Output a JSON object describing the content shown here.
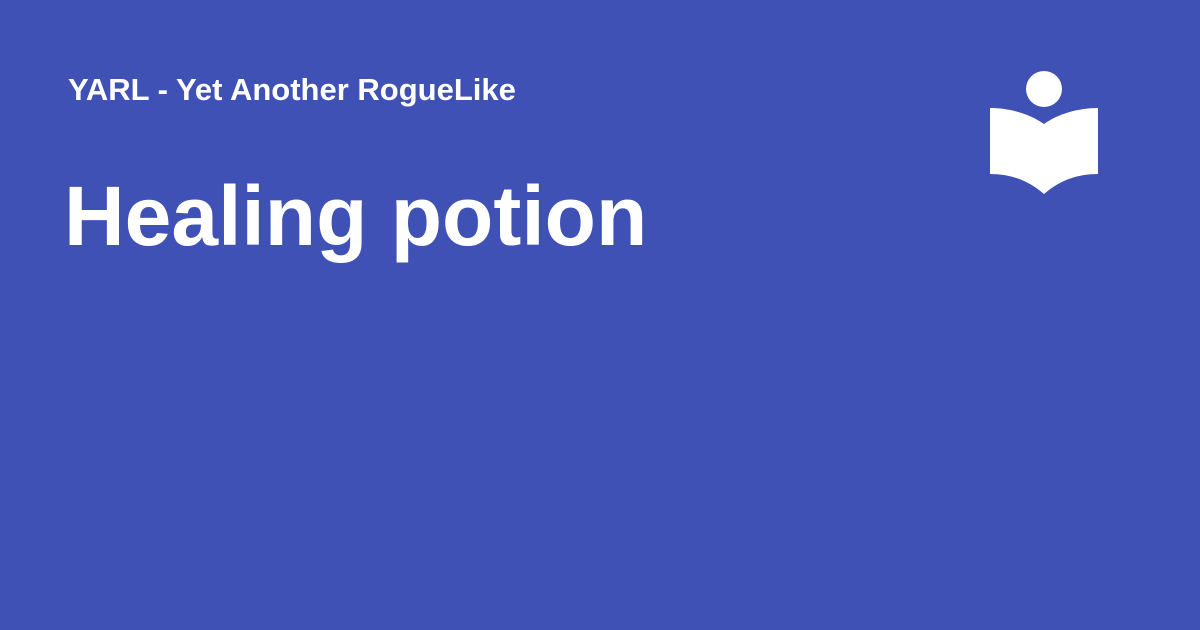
{
  "site": {
    "name": "YARL - Yet Another RogueLike"
  },
  "page": {
    "title": "Healing potion"
  },
  "logo": {
    "icon": "reader-book-icon"
  },
  "colors": {
    "background": "#3f51b5",
    "foreground": "#ffffff"
  }
}
